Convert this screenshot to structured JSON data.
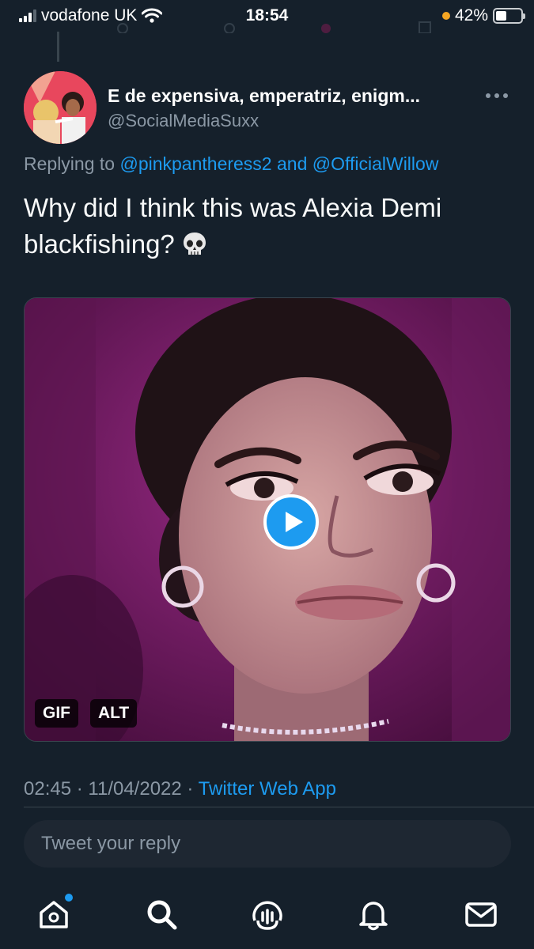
{
  "status_bar": {
    "carrier": "vodafone UK",
    "time": "18:54",
    "battery_percent": "42%",
    "battery_level": 0.42
  },
  "tweet": {
    "author_name": "E de expensiva, emperatriz, enigm...",
    "author_handle": "@SocialMediaSuxx",
    "replying_prefix": "Replying to",
    "reply_mention_1": "@pinkpantheress2",
    "reply_and": "and",
    "reply_mention_2": "@OfficialWillow",
    "text_line_1": "Why did I think this was Alexia Demi",
    "text_line_2": "blackfishing?",
    "emoji_icon": "skull-emoji-icon",
    "media": {
      "gif_label": "GIF",
      "alt_label": "ALT",
      "play_icon": "play-icon"
    },
    "time": "02:45",
    "date": "11/04/2022",
    "separator": "·",
    "source": "Twitter Web App"
  },
  "reply": {
    "placeholder": "Tweet your reply"
  },
  "tab_bar": {
    "items": [
      "home-icon",
      "search-icon",
      "spaces-icon",
      "notifications-icon",
      "messages-icon"
    ]
  },
  "colors": {
    "background": "#15202b",
    "accent": "#1d9bf0",
    "secondary_text": "#8b98a5",
    "divider": "#38444d",
    "battery_low": "#f5a623"
  }
}
